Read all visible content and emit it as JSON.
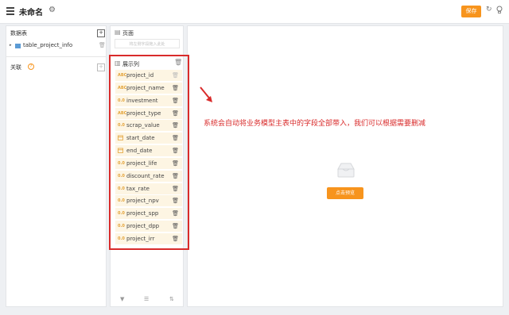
{
  "header": {
    "title": "未命名",
    "save_label": "保存",
    "icons": [
      "menu-icon",
      "gear-icon",
      "refresh-icon",
      "bulb-icon"
    ]
  },
  "left_panel": {
    "dataset_title": "数据表",
    "table_name": "table_project_info",
    "relation_title": "关联"
  },
  "middle_panel": {
    "page_title": "页面",
    "page_placeholder": "将左侧字段拖入此处",
    "display_title": "展示列",
    "fields": [
      {
        "type": "ABC",
        "name": "project_id"
      },
      {
        "type": "ABC",
        "name": "project_name"
      },
      {
        "type": "0.0",
        "name": "investment"
      },
      {
        "type": "ABC",
        "name": "project_type"
      },
      {
        "type": "0.0",
        "name": "scrap_value"
      },
      {
        "type": "date",
        "name": "start_date"
      },
      {
        "type": "date",
        "name": "end_date"
      },
      {
        "type": "0.0",
        "name": "project_life"
      },
      {
        "type": "0.0",
        "name": "discount_rate"
      },
      {
        "type": "0.0",
        "name": "tax_rate"
      },
      {
        "type": "0.0",
        "name": "project_npv"
      },
      {
        "type": "0.0",
        "name": "project_spp"
      },
      {
        "type": "0.0",
        "name": "project_dpp"
      },
      {
        "type": "0.0",
        "name": "project_irr"
      }
    ]
  },
  "main": {
    "annotation": "系统会自动将业务模型主表中的字段全部带入，我们可以根据需要删减",
    "preview_label": "点击预览"
  },
  "colors": {
    "accent": "#f7941d",
    "annotation_red": "#d92b2b",
    "field_bg": "#fdf5e3"
  }
}
